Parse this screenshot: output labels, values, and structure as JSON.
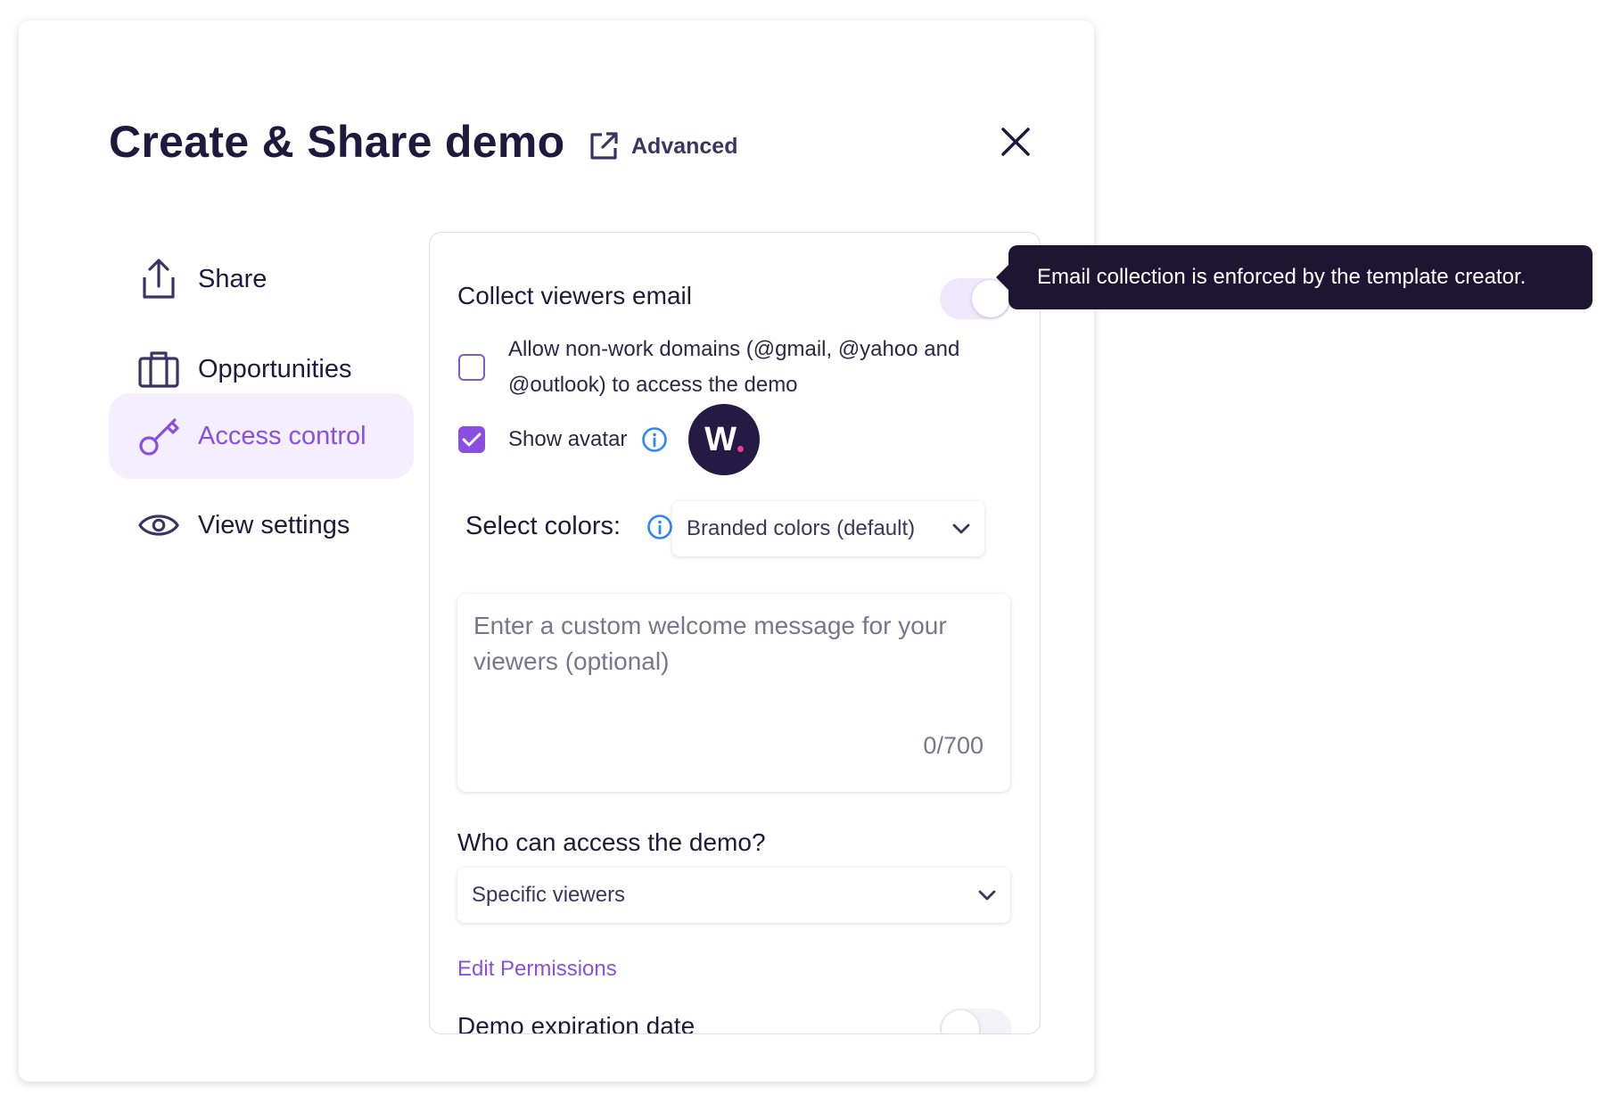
{
  "header": {
    "title": "Create & Share demo",
    "advanced_label": "Advanced",
    "advanced_icon": "external-link-icon",
    "close_icon": "close-icon"
  },
  "sidebar": {
    "items": [
      {
        "label": "Share",
        "icon": "share-upload-icon",
        "active": false
      },
      {
        "label": "Opportunities",
        "icon": "briefcase-icon",
        "active": false
      },
      {
        "label": "Access control",
        "icon": "key-icon",
        "active": true
      },
      {
        "label": "View settings",
        "icon": "eye-icon",
        "active": false
      }
    ]
  },
  "access": {
    "collect_email": {
      "label": "Collect viewers email",
      "enabled": true
    },
    "allow_domains": {
      "line1": "Allow non-work domains (@gmail, @yahoo and",
      "line2": "@outlook) to access the demo",
      "checked": false
    },
    "show_avatar": {
      "label": "Show avatar",
      "checked": true,
      "avatar_letter": "W"
    },
    "select_colors": {
      "label": "Select colors:",
      "value": "Branded colors (default)"
    },
    "welcome": {
      "placeholder_line1": "Enter a custom welcome message for your",
      "placeholder_line2": "viewers (optional)",
      "counter": "0/700"
    },
    "who_access": {
      "label": "Who can access the demo?",
      "value": "Specific viewers"
    },
    "edit_permissions": "Edit Permissions",
    "expiration": {
      "label": "Demo expiration date",
      "enabled": false
    }
  },
  "tooltip": {
    "text": "Email collection is enforced by the template creator."
  },
  "colors": {
    "accent": "#8a4fe0",
    "dark": "#1f1a3d",
    "active_bg": "#f4efff",
    "toggle_on_track": "#efe8fd",
    "toggle_off_track": "#f3f2f6",
    "info": "#2f86f5"
  }
}
